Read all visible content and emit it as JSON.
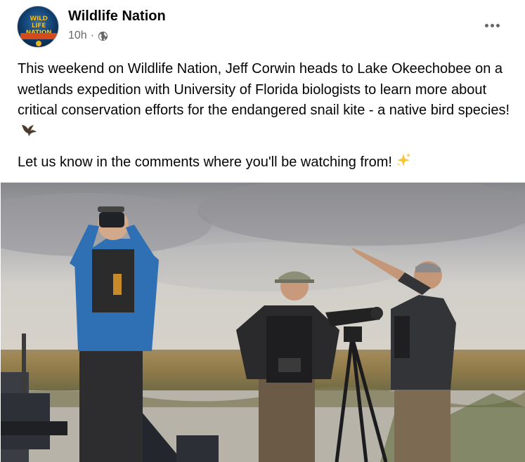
{
  "post": {
    "page_name": "Wildlife Nation",
    "timestamp": "10h",
    "separator": "·",
    "audience_icon": "globe-icon",
    "more_icon": "more-options-icon",
    "avatar_logo_text": "WILDLIFE NATION",
    "paragraphs": [
      "This weekend on Wildlife Nation, Jeff Corwin heads to Lake Okeechobee on a wetlands expedition with University of Florida biologists to learn more about critical conservation efforts for the endangered snail kite - a native bird species!",
      "Let us know in the comments where you'll be watching from!"
    ],
    "emoji_1": "bird-emoji",
    "emoji_2": "sparkles-emoji",
    "photo": "people-on-airboat-in-wetlands-photo"
  }
}
